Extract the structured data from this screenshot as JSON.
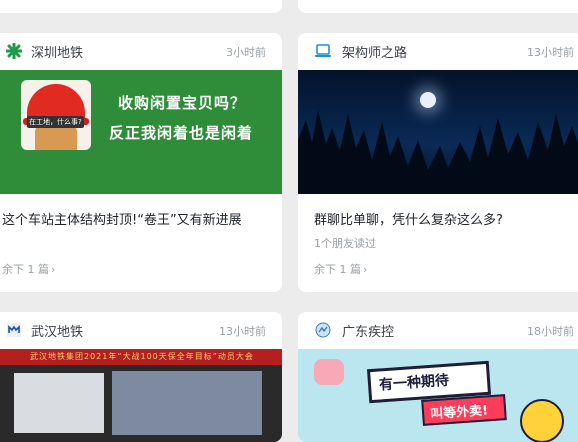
{
  "feed": [
    {
      "account": "深圳地铁",
      "time": "3小时前",
      "icon": "metro-logo-icon",
      "thumbnail": {
        "line1": "收购闲置宝贝吗？",
        "line2": "反正我闲着也是闲着",
        "badge": "在工地，什么事?"
      },
      "title": "这个车站主体结构封顶!“卷王”又有新进展",
      "more": "余下 1 篇"
    },
    {
      "account": "架构师之路",
      "time": "13小时前",
      "icon": "laptop-icon",
      "title": "群聊比单聊，凭什么复杂这么多?",
      "friends": "1个朋友读过",
      "more": "余下 1 篇"
    },
    {
      "account": "武汉地铁",
      "time": "13小时前",
      "icon": "wuhan-metro-logo-icon",
      "thumbnail": {
        "banner": "武汉地铁集团2021年“大战100天保全年目标”动员大会"
      }
    },
    {
      "account": "广东疾控",
      "time": "18小时前",
      "icon": "cdc-logo-icon",
      "thumbnail": {
        "line1": "有一种期待",
        "line2": "叫等外卖!"
      }
    }
  ],
  "colors": {
    "background": "#ececec",
    "card": "#ffffff",
    "metro_green": "#2f8d3a"
  }
}
